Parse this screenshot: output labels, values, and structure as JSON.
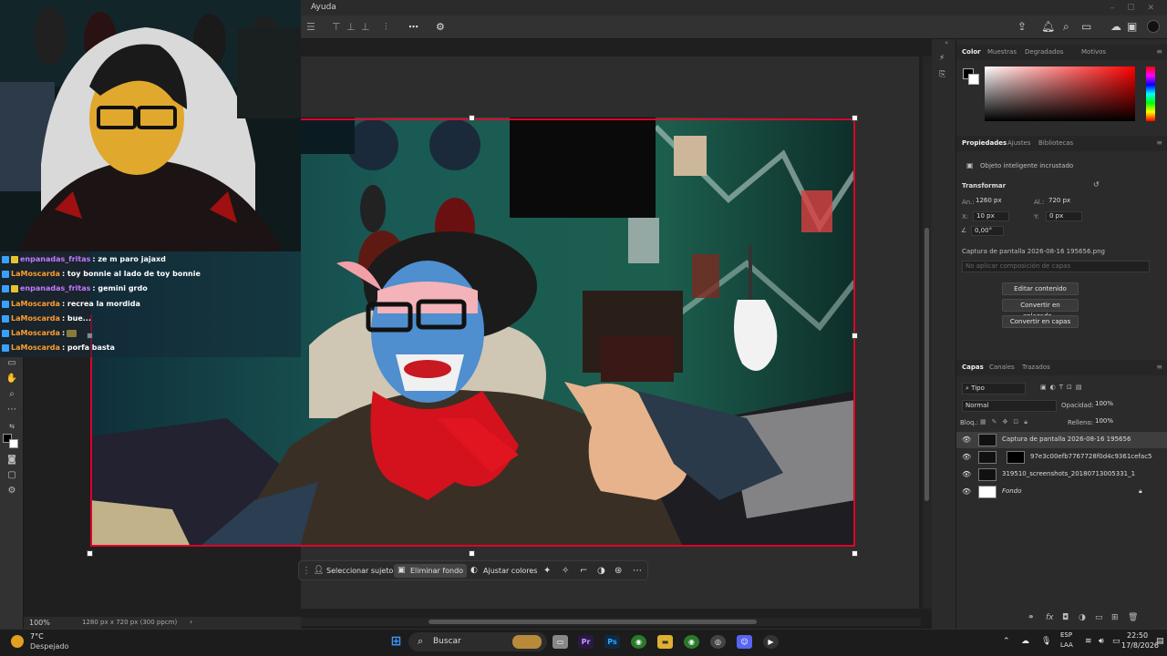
{
  "menubar": {
    "help": "Ayuda"
  },
  "window": {
    "minimize": "–",
    "maximize": "☐",
    "close": "✕"
  },
  "chat": [
    {
      "user": "enpanadas_fritas",
      "message": " : ze m paro jajaxd",
      "color": "purple"
    },
    {
      "user": "LaMoscarda",
      "message": " : toy bonnie al lado de toy bonnie",
      "color": "orange"
    },
    {
      "user": "enpanadas_fritas",
      "message": " : gemini grdo",
      "color": "purple"
    },
    {
      "user": "LaMoscarda",
      "message": " : recrea la mordida",
      "color": "orange"
    },
    {
      "user": "LaMoscarda",
      "message": " : bue...",
      "color": "orange"
    },
    {
      "user": "LaMoscarda",
      "message": " : ",
      "color": "orange"
    },
    {
      "user": "LaMoscarda",
      "message": " : porfa basta",
      "color": "orange"
    }
  ],
  "status": {
    "zoom": "100%",
    "doc_size": "1280 px x 720 px (300 ppcm)",
    "arrow": "›"
  },
  "contextual_bar": {
    "select_subject": "Seleccionar sujeto",
    "remove_background": "Eliminar fondo",
    "adjust_colors": "Ajustar colores"
  },
  "color_panel": {
    "tabs": [
      "Color",
      "Muestras",
      "Degradados",
      "Motivos"
    ]
  },
  "properties_panel": {
    "tabs": [
      "Propiedades",
      "Ajustes",
      "Bibliotecas"
    ],
    "object_type": "Objeto inteligente incrustado",
    "transform_title": "Transformar",
    "w_label": "An.:",
    "w_value": "1260 px",
    "h_label": "Al.:",
    "h_value": "720 px",
    "x_label": "X:",
    "x_value": "10 px",
    "y_label": "Y:",
    "y_value": "0 px",
    "angle_value": "0,00°",
    "filename": "Captura de pantalla 2026-08-16 195656.png",
    "comp_placeholder": "No aplicar composición de capas",
    "buttons": [
      "Editar contenido",
      "Convertir en enlazado...",
      "Convertir en capas"
    ]
  },
  "layers_panel": {
    "tabs": [
      "Capas",
      "Canales",
      "Trazados"
    ],
    "filter": "Tipo",
    "blend_mode": "Normal",
    "opacity_label": "Opacidad:",
    "opacity_value": "100%",
    "lock_label": "Bloq.:",
    "fill_label": "Relleno:",
    "fill_value": "100%",
    "layers": [
      {
        "name": "Captura de pantalla 2026-08-16 195656",
        "selected": true
      },
      {
        "name": "97e3c00efb7767728f0d4c9361cefac5",
        "selected": false
      },
      {
        "name": "319510_screenshots_20180713005331_1",
        "selected": false
      },
      {
        "name": "Fondo",
        "selected": false
      }
    ]
  },
  "taskbar": {
    "temperature": "7°C",
    "weather": "Despejado",
    "search": "Buscar",
    "language": "ESP",
    "keyboard": "LAA",
    "time": "22:50",
    "date": "17/8/2026"
  },
  "colors": {
    "selection_red": "#e0002a",
    "accent_purple": "#c27bff",
    "accent_orange": "#ff9d2e"
  }
}
